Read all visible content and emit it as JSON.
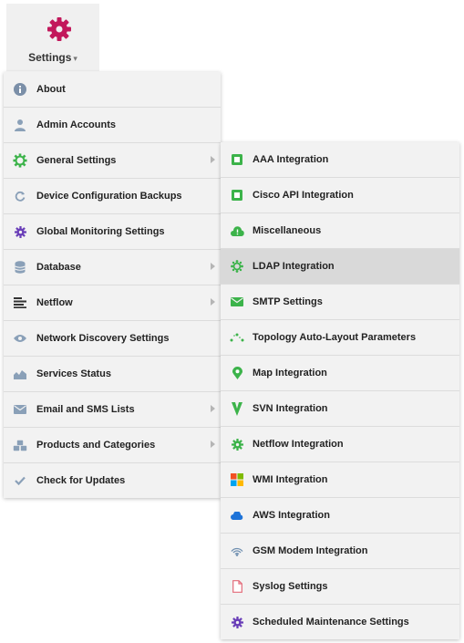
{
  "tab": {
    "label": "Settings",
    "caret": "▾",
    "gear_color": "#c2185b"
  },
  "main_menu": [
    {
      "label": "About",
      "icon": "info-icon",
      "has_submenu": false
    },
    {
      "label": "Admin Accounts",
      "icon": "user-icon",
      "has_submenu": false
    },
    {
      "label": "General Settings",
      "icon": "gear-icon",
      "has_submenu": true,
      "open": true
    },
    {
      "label": "Device Configuration Backups",
      "icon": "refresh-icon",
      "has_submenu": false
    },
    {
      "label": "Global Monitoring Settings",
      "icon": "gear-icon",
      "has_submenu": false
    },
    {
      "label": "Database",
      "icon": "database-icon",
      "has_submenu": true
    },
    {
      "label": "Netflow",
      "icon": "list-icon",
      "has_submenu": true
    },
    {
      "label": "Network Discovery Settings",
      "icon": "eye-icon",
      "has_submenu": false
    },
    {
      "label": "Services Status",
      "icon": "area-chart-icon",
      "has_submenu": false
    },
    {
      "label": "Email and SMS Lists",
      "icon": "envelope-icon",
      "has_submenu": true
    },
    {
      "label": "Products and Categories",
      "icon": "cubes-icon",
      "has_submenu": true
    },
    {
      "label": "Check for Updates",
      "icon": "check-icon",
      "has_submenu": false
    }
  ],
  "sub_menu": [
    {
      "label": "AAA Integration",
      "icon": "aaa-icon"
    },
    {
      "label": "Cisco API Integration",
      "icon": "cisco-api-icon"
    },
    {
      "label": "Miscellaneous",
      "icon": "cloud-alert-icon"
    },
    {
      "label": "LDAP Integration",
      "icon": "ldap-icon",
      "active": true
    },
    {
      "label": "SMTP Settings",
      "icon": "envelope-icon"
    },
    {
      "label": "Topology Auto-Layout Parameters",
      "icon": "topology-icon"
    },
    {
      "label": "Map Integration",
      "icon": "map-pin-icon"
    },
    {
      "label": "SVN Integration",
      "icon": "svn-icon"
    },
    {
      "label": "Netflow Integration",
      "icon": "gear-icon"
    },
    {
      "label": "WMI Integration",
      "icon": "windows-icon"
    },
    {
      "label": "AWS Integration",
      "icon": "cloud-icon"
    },
    {
      "label": "GSM Modem Integration",
      "icon": "signal-icon"
    },
    {
      "label": "Syslog Settings",
      "icon": "file-icon"
    },
    {
      "label": "Scheduled Maintenance Settings",
      "icon": "gear-icon"
    }
  ]
}
